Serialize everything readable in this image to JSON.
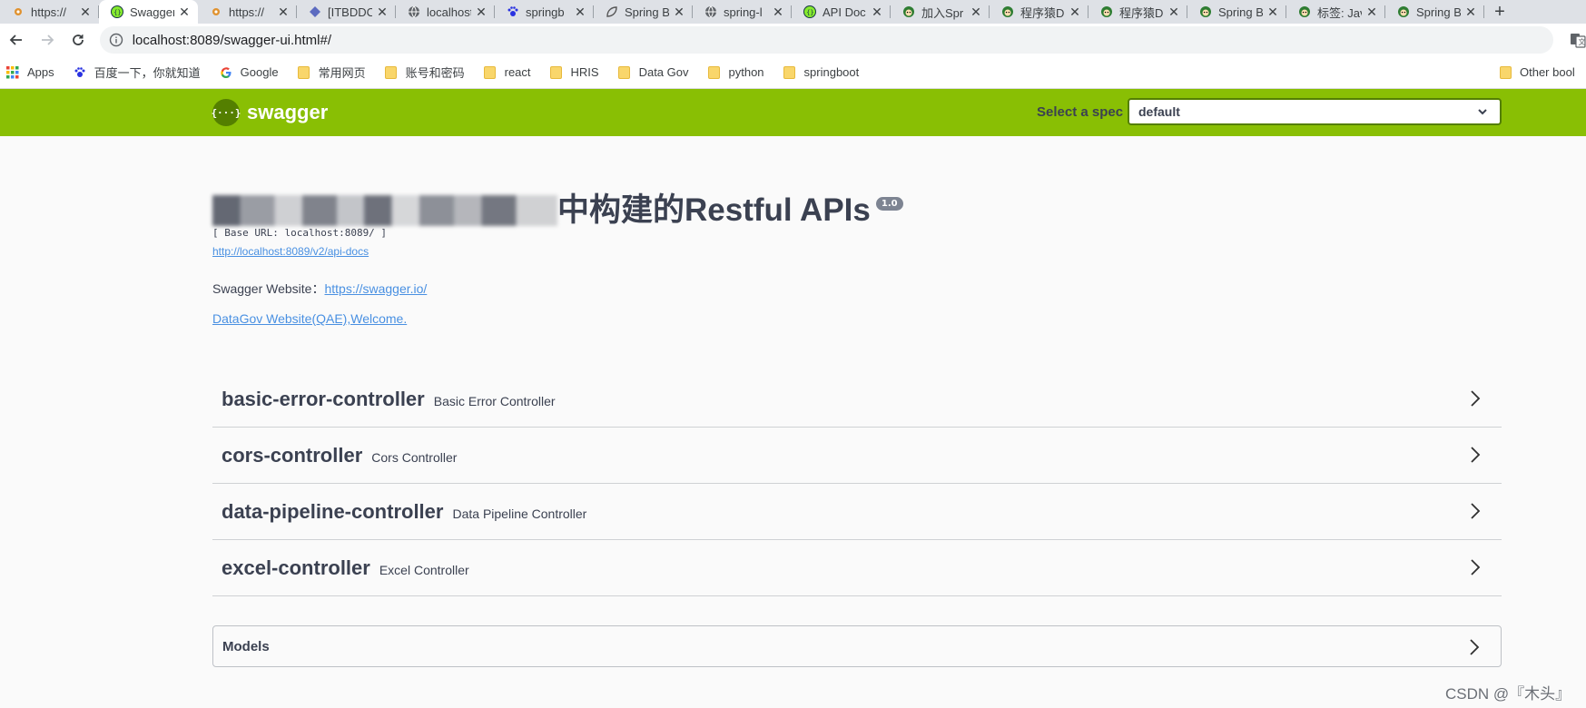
{
  "browser": {
    "tabs": [
      {
        "title": "https://",
        "icon": "gear-star-icon",
        "active": false
      },
      {
        "title": "Swagger",
        "icon": "swagger-icon",
        "active": true
      },
      {
        "title": "https://",
        "icon": "gear-star-icon",
        "active": false
      },
      {
        "title": "[ITBDDC",
        "icon": "diamond-icon",
        "active": false
      },
      {
        "title": "localhost",
        "icon": "globe-icon",
        "active": false
      },
      {
        "title": "springb",
        "icon": "paw-icon",
        "active": false
      },
      {
        "title": "Spring B",
        "icon": "leaf-icon",
        "active": false
      },
      {
        "title": "spring-l",
        "icon": "globe-icon",
        "active": false
      },
      {
        "title": "API Doc",
        "icon": "swagger-icon",
        "active": false
      },
      {
        "title": "加入Spr",
        "icon": "avatar-icon",
        "active": false
      },
      {
        "title": "程序猿D",
        "icon": "avatar-icon",
        "active": false
      },
      {
        "title": "程序猿D",
        "icon": "avatar-icon",
        "active": false
      },
      {
        "title": "Spring B",
        "icon": "avatar-icon",
        "active": false
      },
      {
        "title": "标签: Jav",
        "icon": "avatar-icon",
        "active": false
      },
      {
        "title": "Spring B",
        "icon": "avatar-icon",
        "active": false
      }
    ],
    "new_tab": "+",
    "close_glyph": "✕",
    "url": "localhost:8089/swagger-ui.html#/",
    "bookmarks": [
      {
        "label": "Apps",
        "icon": "apps-grid-icon"
      },
      {
        "label": "百度一下，你就知道",
        "icon": "baidu-paw-icon"
      },
      {
        "label": "Google",
        "icon": "google-icon"
      },
      {
        "label": "常用网页",
        "icon": "folder-icon"
      },
      {
        "label": "账号和密码",
        "icon": "folder-icon"
      },
      {
        "label": "react",
        "icon": "folder-icon"
      },
      {
        "label": "HRIS",
        "icon": "folder-icon"
      },
      {
        "label": "Data Gov",
        "icon": "folder-icon"
      },
      {
        "label": "python",
        "icon": "folder-icon"
      },
      {
        "label": "springboot",
        "icon": "folder-icon"
      }
    ],
    "other_bookmarks": "Other bool"
  },
  "swagger": {
    "logo_text": "swagger",
    "logo_glyph": "{···}",
    "spec_label": "Select a spec",
    "spec_value": "default",
    "brand_color": "#89bf04"
  },
  "info": {
    "title_suffix": "中构建的Restful APIs",
    "version": "1.0",
    "base_url": "[ Base URL: localhost:8089/ ]",
    "api_docs_link": "http://localhost:8089/v2/api-docs",
    "website_label": "Swagger Website：",
    "website_link": "https://swagger.io/",
    "welcome_link": "DataGov Website(QAE),Welcome."
  },
  "controllers": [
    {
      "name": "basic-error-controller",
      "desc": "Basic Error Controller"
    },
    {
      "name": "cors-controller",
      "desc": "Cors Controller"
    },
    {
      "name": "data-pipeline-controller",
      "desc": "Data Pipeline Controller"
    },
    {
      "name": "excel-controller",
      "desc": "Excel Controller"
    }
  ],
  "models_label": "Models",
  "watermark": "CSDN @『木头』"
}
